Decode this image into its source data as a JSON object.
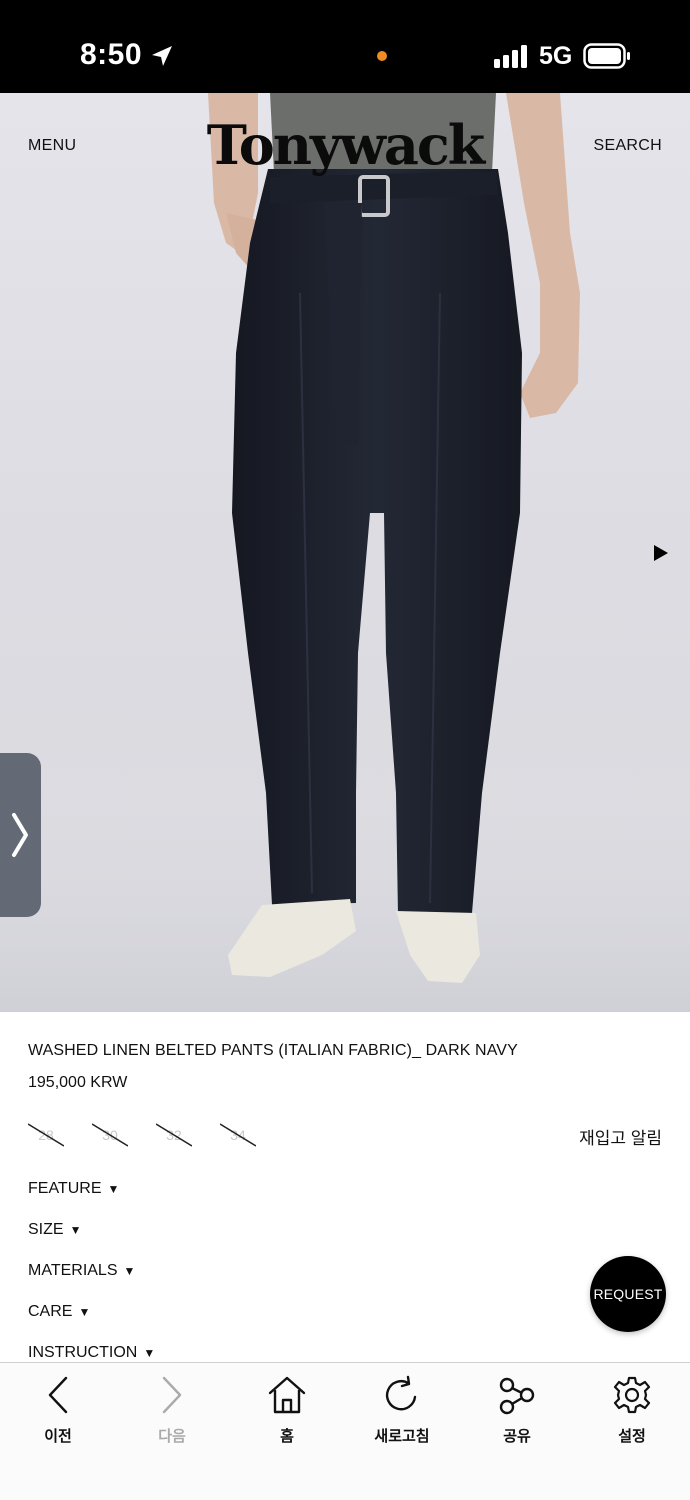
{
  "status_bar": {
    "time": "8:50",
    "network": "5G",
    "recording_dot_color": "#f08a24"
  },
  "header": {
    "menu_label": "MENU",
    "logo_text": "Tonywack",
    "search_label": "SEARCH",
    "next_image_icon": "play-triangle"
  },
  "product": {
    "name": "WASHED LINEN BELTED PANTS (ITALIAN FABRIC)_ DARK NAVY",
    "price": "195,000 KRW",
    "sizes": [
      "28",
      "30",
      "32",
      "34"
    ],
    "sizes_sold_out": true,
    "restock_label": "재입고 알림"
  },
  "accordions": [
    {
      "label": "FEATURE",
      "arrow": "▼"
    },
    {
      "label": "SIZE",
      "arrow": "▼"
    },
    {
      "label": "MATERIALS",
      "arrow": "▼"
    },
    {
      "label": "CARE",
      "arrow": "▼"
    },
    {
      "label": "INSTRUCTION",
      "arrow": "▼"
    }
  ],
  "request_button": {
    "label": "REQUEST"
  },
  "toolbar": {
    "items": [
      {
        "label": "이전",
        "icon": "chevron-left-icon",
        "enabled": true
      },
      {
        "label": "다음",
        "icon": "chevron-right-icon",
        "enabled": false
      },
      {
        "label": "홈",
        "icon": "home-icon",
        "enabled": true
      },
      {
        "label": "새로고침",
        "icon": "refresh-icon",
        "enabled": true
      },
      {
        "label": "공유",
        "icon": "share-icon",
        "enabled": true
      },
      {
        "label": "설정",
        "icon": "gear-icon",
        "enabled": true
      }
    ]
  },
  "colors": {
    "accent": "#000000",
    "side_tab": "#636a76",
    "pants": "#1d212b"
  }
}
